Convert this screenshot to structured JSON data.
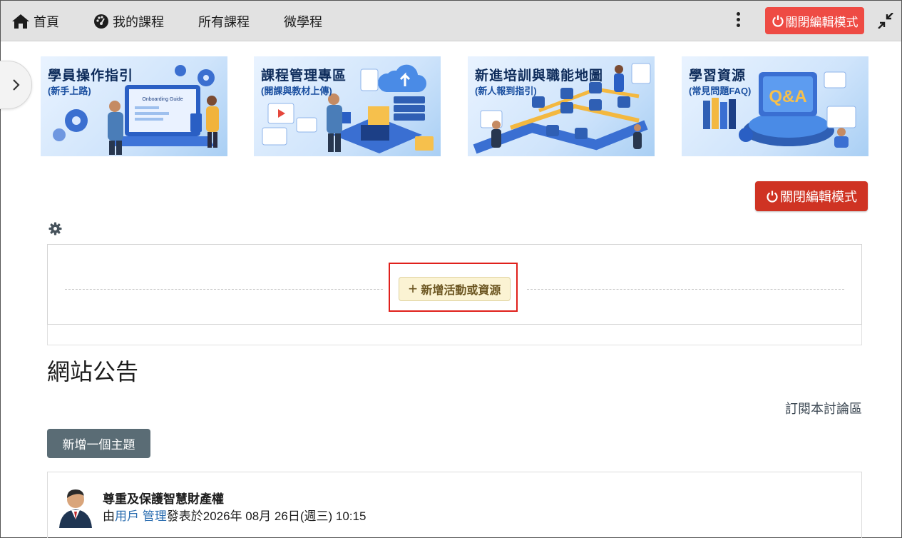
{
  "navbar": {
    "home": "首頁",
    "my_courses": "我的課程",
    "all_courses": "所有課程",
    "micro": "微學程",
    "edit_mode_button": "關閉編輯模式"
  },
  "banners": [
    {
      "title": "學員操作指引",
      "subtitle": "(新手上路)",
      "art_text": "Onboarding Guide"
    },
    {
      "title": "課程管理專區",
      "subtitle": "(開課與教材上傳)"
    },
    {
      "title": "新進培訓與職能地圖",
      "subtitle": "(新人報到指引)"
    },
    {
      "title": "學習資源",
      "subtitle": "(常見問題FAQ)",
      "art_text": "Q&A"
    }
  ],
  "main": {
    "edit_mode_button": "關閉編輯模式",
    "add_activity": "新增活動或資源",
    "add_icon": "+"
  },
  "forum": {
    "title": "網站公告",
    "subscribe": "訂閱本討論區",
    "new_topic": "新增一個主題",
    "post": {
      "title": "尊重及保護智慧財產權",
      "by_prefix": "由",
      "author": "用戶 管理",
      "posted_on": "發表於2026年 08月 26日(週三) 10:15"
    }
  },
  "colors": {
    "navbar_bg": "#e2e2e2",
    "edit_button_top": "#ee4b44",
    "edit_button_main": "#cf3323",
    "add_activity_bg": "#fbf3d3",
    "highlight_border": "#e0201b",
    "new_topic_bg": "#5a6c75",
    "link": "#2a6db0"
  }
}
